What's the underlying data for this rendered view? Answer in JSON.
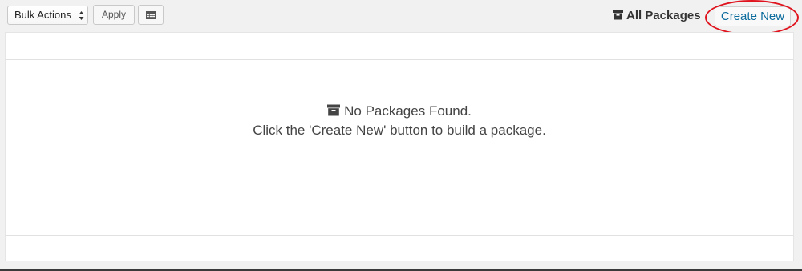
{
  "toolbar": {
    "bulk_actions": {
      "selected": "Bulk Actions"
    },
    "apply_label": "Apply",
    "grid_icon": "grid-icon",
    "all_packages_label": "All Packages",
    "all_packages_icon": "archive-icon",
    "create_new_label": "Create New"
  },
  "table": {
    "empty_title": "No Packages Found.",
    "empty_subtitle": "Click the 'Create New' button to build a package.",
    "empty_icon": "archive-icon"
  },
  "colors": {
    "link": "#0b6b9d",
    "highlight": "#e0141e",
    "background": "#f1f1f1"
  }
}
